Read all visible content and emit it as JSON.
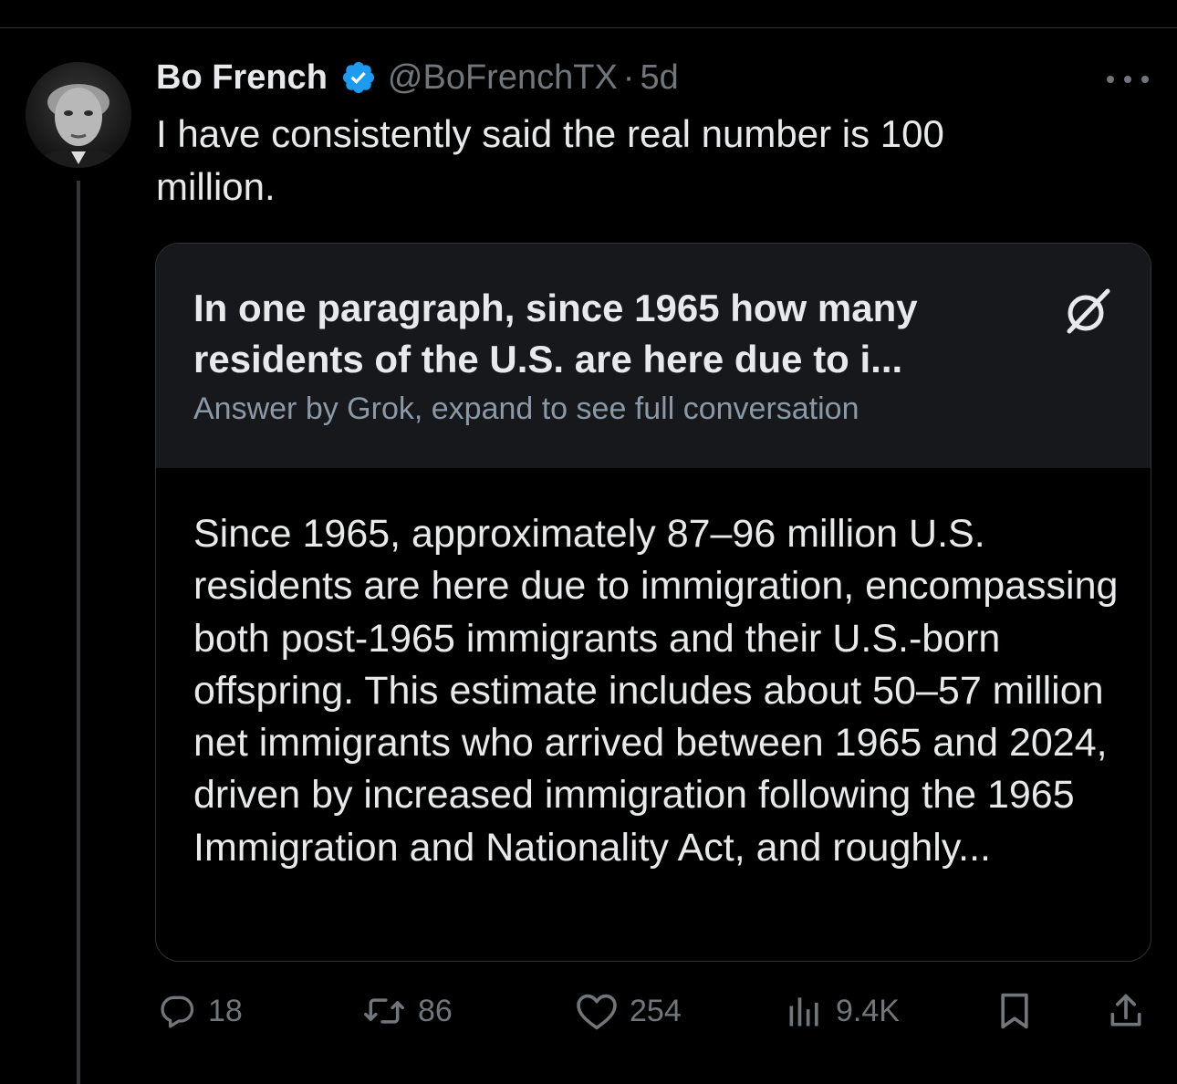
{
  "tweet": {
    "author_name": "Bo French",
    "handle": "@BoFrenchTX",
    "separator": "·",
    "time": "5d",
    "text": "I have consistently said the real number is 100\nmillion."
  },
  "grok_card": {
    "title": "In one paragraph, since 1965 how many residents of the U.S. are here due to i...",
    "subtitle": "Answer by Grok, expand to see full conversation",
    "body": "Since 1965, approximately 87–96 million U.S. residents are here due to immigration, encompassing both post-1965 immigrants and their U.S.-born offspring. This estimate includes about 50–57 million net immigrants who arrived between 1965 and 2024, driven by increased immigration following the 1965 Immigration and Nationality Act, and roughly..."
  },
  "actions": {
    "replies": "18",
    "reposts": "86",
    "likes": "254",
    "views": "9.4K"
  },
  "icons": {
    "verified": "verified-badge-icon",
    "more": "more-icon",
    "grok": "grok-logo-icon",
    "reply": "reply-icon",
    "repost": "repost-icon",
    "like": "heart-icon",
    "views": "views-icon",
    "bookmark": "bookmark-icon",
    "share": "share-icon"
  },
  "colors": {
    "background": "#000000",
    "text": "#e7e9ea",
    "muted": "#71767b",
    "verified": "#1d9bf0",
    "card_header": "#16181c",
    "card_subtitle": "#8b98a5"
  }
}
